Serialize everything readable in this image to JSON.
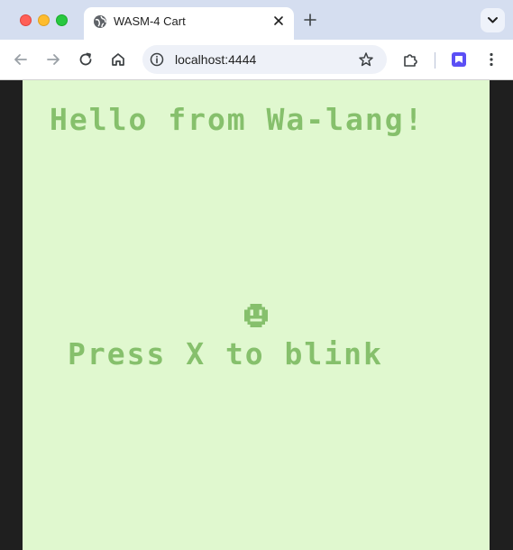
{
  "browser": {
    "tab_title": "WASM-4 Cart",
    "url": "localhost:4444"
  },
  "game": {
    "headline": "Hello from Wa-lang!",
    "prompt": "Press X to blink"
  },
  "colors": {
    "screen_bg": "#e0f8cf",
    "pixel_text": "#86c06c",
    "letterbox": "#1f1f1f"
  }
}
